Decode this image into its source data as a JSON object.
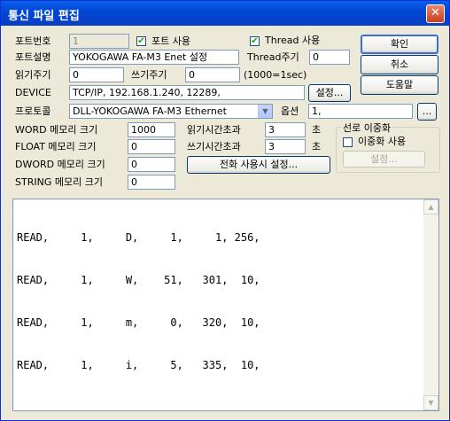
{
  "window": {
    "title": "통신 파일 편집",
    "close_glyph": "✕"
  },
  "port_number": {
    "label": "포트번호",
    "value": "1"
  },
  "port_use": {
    "label": "포트 사용",
    "checked": true
  },
  "thread_use": {
    "label": "Thread 사용",
    "checked": true
  },
  "port_desc": {
    "label": "포트설명",
    "value": "YOKOGAWA FA-M3 Enet 설정"
  },
  "thread_period": {
    "label": "Thread주기",
    "value": "0"
  },
  "read_period": {
    "label": "읽기주기",
    "value": "0"
  },
  "write_period": {
    "label": "쓰기주기",
    "value": "0"
  },
  "period_unit": "(1000=1sec)",
  "device": {
    "label": "DEVICE",
    "value": "TCP/IP, 192.168.1.240, 12289,",
    "settings_button": "설정..."
  },
  "protocol": {
    "label": "프로토콜",
    "value": "DLL-YOKOGAWA FA-M3 Ethernet",
    "option_label": "옵션",
    "option_value": "1,",
    "option_button": "..."
  },
  "memory": {
    "word_label": "WORD 메모리 크기",
    "word_value": "1000",
    "float_label": "FLOAT 메모리 크기",
    "float_value": "0",
    "dword_label": "DWORD 메모리 크기",
    "dword_value": "0",
    "string_label": "STRING 메모리 크기",
    "string_value": "0"
  },
  "timeouts": {
    "read_label": "읽기시간초과",
    "read_value": "3",
    "write_label": "쓰기시간초과",
    "write_value": "3",
    "unit": "초"
  },
  "phone_settings_button": "전화 사용시 설정...",
  "redundancy": {
    "group_title": "선로 이중화",
    "checkbox_label": "이중화 사용",
    "checked": false,
    "settings_button": "설정..."
  },
  "buttons": {
    "ok": "확인",
    "cancel": "취소",
    "help": "도움말"
  },
  "editor_lines": [
    "READ,     1,     D,     1,     1, 256,",
    "READ,     1,     W,    51,   301,  10,",
    "READ,     1,     m,     0,   320,  10,",
    "READ,     1,     i,     5,   335,  10,"
  ]
}
